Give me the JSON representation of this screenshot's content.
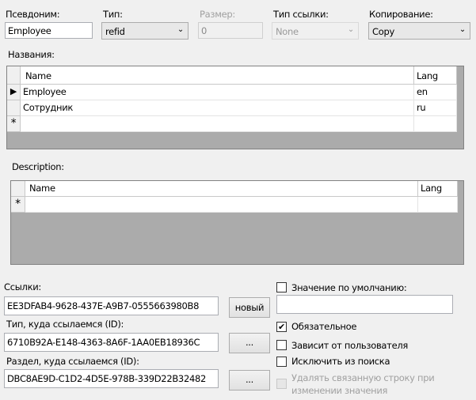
{
  "top": {
    "alias": {
      "label": "Псевдоним:",
      "value": "Employee"
    },
    "type": {
      "label": "Тип:",
      "value": "refid"
    },
    "size": {
      "label": "Размер:",
      "value": "0"
    },
    "link_type": {
      "label": "Тип ссылки:",
      "value": "None"
    },
    "copy": {
      "label": "Копирование:",
      "value": "Copy"
    }
  },
  "names": {
    "label": "Названия:",
    "columns": [
      "Name",
      "Lang"
    ],
    "rows": [
      {
        "name": "Employee",
        "lang": "en"
      },
      {
        "name": "Сотрудник",
        "lang": "ru"
      }
    ],
    "new_row_marker": "*",
    "current_marker": "▶"
  },
  "description": {
    "label": "Description:",
    "columns": [
      "Name",
      "Lang"
    ],
    "new_row_marker": "*"
  },
  "links": {
    "label": "Ссылки:",
    "value": "EE3DFAB4-9628-437E-A9B7-0555663980B8",
    "new_button": "новый",
    "type_label": "Тип, куда ссылаемся (ID):",
    "type_value": "6710B92A-E148-4363-8A6F-1AA0EB18936C",
    "type_button": "...",
    "section_label": "Раздел, куда ссылаемся (ID):",
    "section_value": "DBC8AE9D-C1D2-4D5E-978B-339D22B32482",
    "section_button": "..."
  },
  "options": {
    "default_value": {
      "label": "Значение по умолчанию:",
      "checked": false,
      "value": ""
    },
    "required": {
      "label": "Обязательное",
      "checked": true
    },
    "user_dependent": {
      "label": "Зависит от пользователя",
      "checked": false
    },
    "exclude_search": {
      "label": "Исключить из поиска",
      "checked": false
    },
    "delete_linked": {
      "label_line1": "Удалять связанную строку при",
      "label_line2": "изменении значения",
      "checked": false,
      "enabled": false
    },
    "check_mark": "✔"
  }
}
